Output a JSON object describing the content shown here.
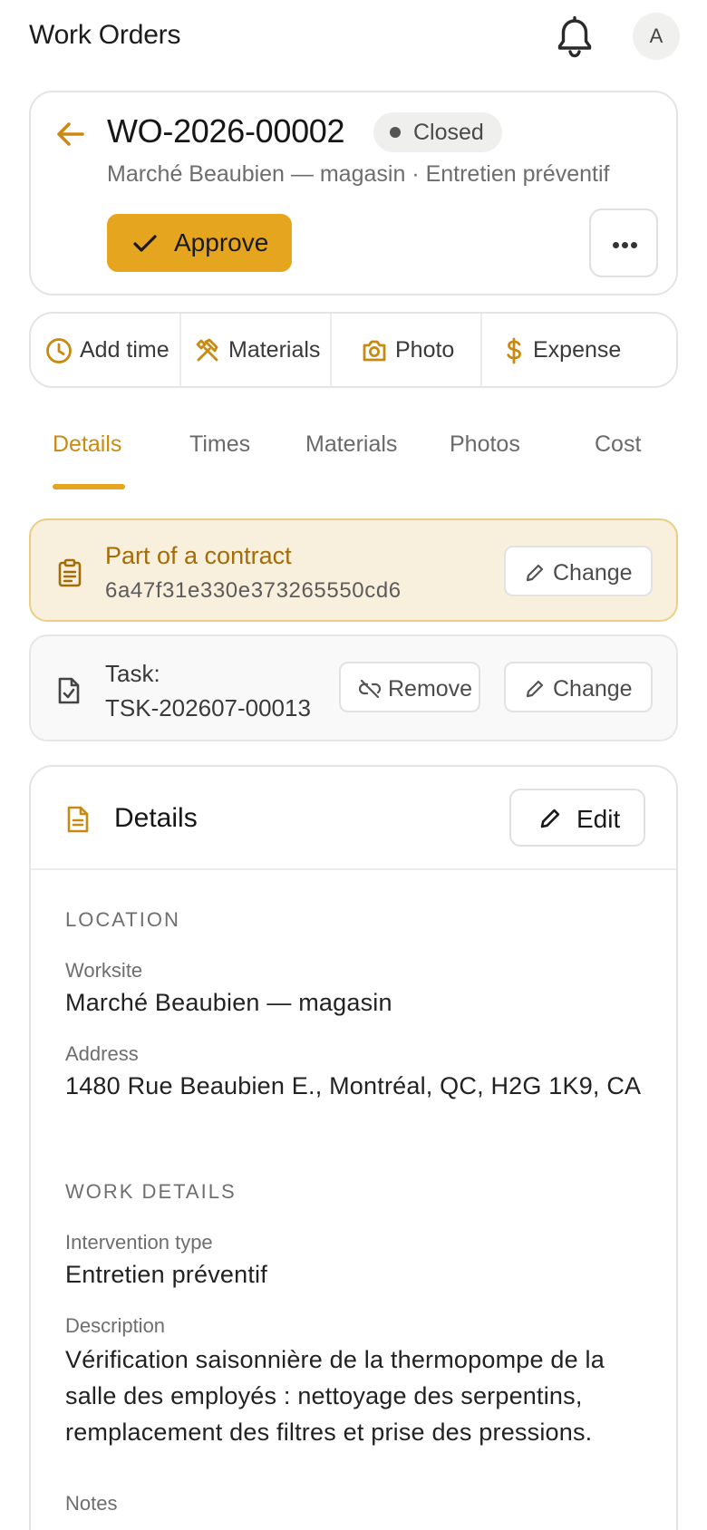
{
  "app": {
    "title": "Work Orders",
    "user_initial": "A",
    "accent_color": "#e6a51f"
  },
  "work_order": {
    "number": "WO-2026-00002",
    "status": "Closed",
    "subtitle": "Marché Beaubien — magasin  ·  Entretien préventif",
    "approve_label": "Approve"
  },
  "quick_actions": [
    {
      "label": "Add time",
      "icon": "clock-icon"
    },
    {
      "label": "Materials",
      "icon": "tools-icon"
    },
    {
      "label": "Photo",
      "icon": "camera-icon"
    },
    {
      "label": "Expense",
      "icon": "dollar-icon"
    }
  ],
  "tabs": [
    {
      "label": "Details",
      "active": true
    },
    {
      "label": "Times",
      "active": false
    },
    {
      "label": "Materials",
      "active": false
    },
    {
      "label": "Photos",
      "active": false
    },
    {
      "label": "Cost",
      "active": false
    }
  ],
  "contract": {
    "title": "Part of a contract",
    "id": "6a47f31e330e373265550cd6",
    "change_label": "Change"
  },
  "task": {
    "label": "Task:",
    "number": "TSK-202607-00013",
    "remove_label": "Remove",
    "change_label": "Change"
  },
  "details": {
    "title": "Details",
    "edit_label": "Edit",
    "location_heading": "LOCATION",
    "worksite_label": "Worksite",
    "worksite_value": "Marché Beaubien — magasin",
    "address_label": "Address",
    "address_value": "1480 Rue Beaubien E., Montréal, QC, H2G 1K9, CA",
    "work_heading": "WORK DETAILS",
    "intervention_label": "Intervention type",
    "intervention_value": "Entretien préventif",
    "description_label": "Description",
    "description_value": "Vérification saisonnière de la thermopompe de la salle des employés : nettoyage des serpentins, remplacement des filtres et prise des pressions.",
    "notes_label": "Notes"
  }
}
